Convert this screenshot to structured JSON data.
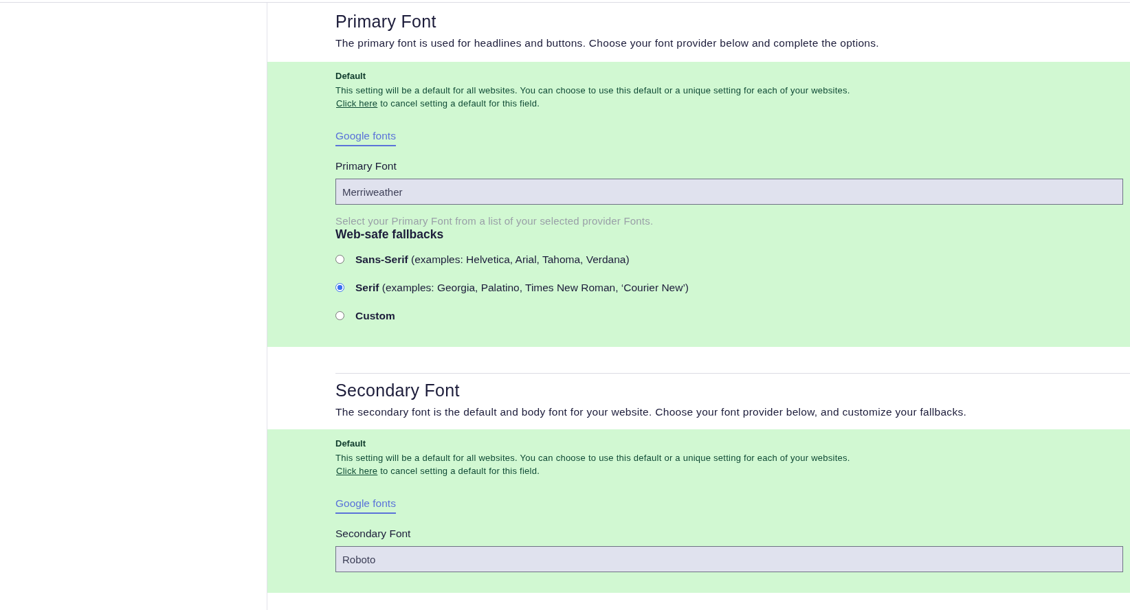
{
  "sections": [
    {
      "title": "Primary Font",
      "description": "The primary font is used for headlines and buttons. Choose your font provider below and complete the options.",
      "note": {
        "title": "Default",
        "text": "This setting will be a default for all websites. You can choose to use this default or a unique setting for each of your websites.",
        "link": "Click here",
        "link_suffix": "to cancel setting a default for this field."
      },
      "tabs": [
        {
          "label": "Google fonts",
          "selected": true
        }
      ],
      "field": {
        "label": "Primary Font",
        "value": "Merriweather"
      },
      "hint": "Select your Primary Font from a list of your selected provider Fonts.",
      "fallbacks": {
        "title": "Web-safe fallbacks",
        "options": [
          {
            "label": "**Sans-Serif** (examples: Helvetica, Arial, Tahoma, Verdana)",
            "selected": false
          },
          {
            "label": "**Serif** (examples: Georgia, Palatino, Times New Roman, ‘Courier New’)",
            "selected": true
          },
          {
            "label": "**Custom**",
            "selected": false
          }
        ]
      }
    },
    {
      "title": "Secondary Font",
      "description": "The secondary font is the default and body font for your website. Choose your font provider below, and customize your fallbacks.",
      "note": {
        "title": "Default",
        "text": "This setting will be a default for all websites. You can choose to use this default or a unique setting for each of your websites.",
        "link": "Click here",
        "link_suffix": "to cancel setting a default for this field."
      },
      "tabs": [
        {
          "label": "Google fonts",
          "selected": true
        }
      ],
      "field": {
        "label": "Secondary Font",
        "value": "Roboto"
      }
    }
  ]
}
